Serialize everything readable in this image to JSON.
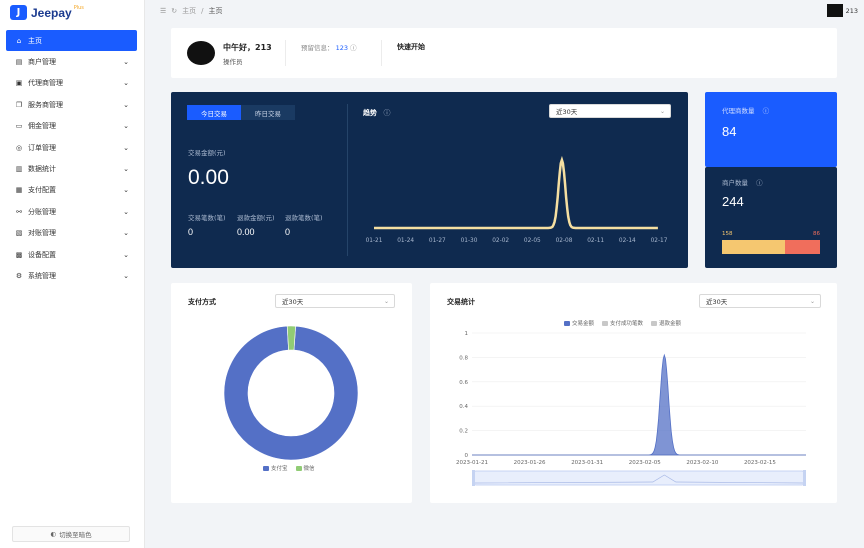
{
  "app": {
    "logo_text": "Jeepay",
    "logo_sup": "Plus",
    "logo_mark": "J"
  },
  "sidebar": {
    "items": [
      {
        "label": "主页",
        "icon": "home-icon",
        "glyph": "⌂",
        "active": true
      },
      {
        "label": "商户管理",
        "icon": "store-icon",
        "glyph": "▤"
      },
      {
        "label": "代理商管理",
        "icon": "agent-icon",
        "glyph": "▣"
      },
      {
        "label": "服务商管理",
        "icon": "provider-icon",
        "glyph": "❐"
      },
      {
        "label": "佣金管理",
        "icon": "commission-icon",
        "glyph": "▭"
      },
      {
        "label": "订单管理",
        "icon": "order-icon",
        "glyph": "◎"
      },
      {
        "label": "数据统计",
        "icon": "stats-icon",
        "glyph": "▥"
      },
      {
        "label": "支付配置",
        "icon": "pay-config-icon",
        "glyph": "▦"
      },
      {
        "label": "分账管理",
        "icon": "split-icon",
        "glyph": "⚯"
      },
      {
        "label": "对账管理",
        "icon": "reconcile-icon",
        "glyph": "▧"
      },
      {
        "label": "设备配置",
        "icon": "device-icon",
        "glyph": "▩"
      },
      {
        "label": "系统管理",
        "icon": "system-icon",
        "glyph": "⚙"
      }
    ],
    "chevron": "⌄",
    "theme_button": "切换至暗色",
    "theme_glyph": "◐"
  },
  "topbar": {
    "menu_glyph": "☰",
    "refresh_glyph": "↻",
    "crumb_home": "主页",
    "crumb_sep": "/",
    "crumb_current": "主页",
    "username": "213"
  },
  "welcome": {
    "greeting": "中午好，213",
    "role": "操作员",
    "notice_label": "预留信息：",
    "notice_value": "123",
    "notice_info_glyph": "ⓘ",
    "quick_start": "快速开始"
  },
  "transactions": {
    "tab_today": "今日交易",
    "tab_yesterday": "昨日交易",
    "amount_label": "交易金额(元)",
    "amount_value": "0.00",
    "count_label": "交易笔数(笔)",
    "count_value": "0",
    "refund_amount_label": "退款金额(元)",
    "refund_amount_value": "0.00",
    "refund_count_label": "退款笔数(笔)",
    "refund_count_value": "0",
    "trend_title": "趋势",
    "trend_info_glyph": "ⓘ",
    "trend_range": "近30天",
    "select_arrow": "⌄"
  },
  "counts": {
    "agent_label": "代理商数量",
    "agent_value": "84",
    "merchant_label": "商户数量",
    "merchant_value": "244",
    "info_glyph": "ⓘ",
    "bar_left_label": "158",
    "bar_right_label": "86",
    "bar_left_value": 158,
    "bar_right_value": 86,
    "bar_left_color": "#f5c770",
    "bar_right_color": "#f06e5c"
  },
  "pay_methods": {
    "title": "支付方式",
    "range": "近30天",
    "legend": [
      {
        "name": "支付宝",
        "color": "#5470c6"
      },
      {
        "name": "微信",
        "color": "#91cc75"
      }
    ]
  },
  "stats": {
    "title": "交易统计",
    "range": "近30天",
    "legend": [
      {
        "name": "交易金额",
        "color": "#5470c6"
      },
      {
        "name": "支付成功笔数",
        "color": "#c8c8c8"
      },
      {
        "name": "退款金额",
        "color": "#c8c8c8"
      }
    ]
  },
  "chart_data": [
    {
      "type": "line",
      "title": "趋势",
      "categories": [
        "01-21",
        "01-24",
        "01-27",
        "01-30",
        "02-02",
        "02-05",
        "02-08",
        "02-11",
        "02-14",
        "02-17"
      ],
      "x_days": [
        0,
        3,
        6,
        9,
        12,
        15,
        18,
        21,
        24,
        27
      ],
      "peak_day": 17.8,
      "peak_value": 1,
      "color": "#f5dfa1"
    },
    {
      "type": "pie",
      "title": "支付方式",
      "labels": [
        "支付宝",
        "微信"
      ],
      "values": [
        98,
        2
      ],
      "colors": [
        "#5470c6",
        "#91cc75"
      ]
    },
    {
      "type": "area",
      "title": "交易统计",
      "x_ticks": [
        "2023-01-21",
        "2023-01-26",
        "2023-01-31",
        "2023-02-05",
        "2023-02-10",
        "2023-02-15"
      ],
      "y_ticks": [
        "0",
        "0.2",
        "0.4",
        "0.6",
        "0.8",
        "1"
      ],
      "ylim": [
        0,
        1
      ],
      "series": [
        {
          "name": "交易金额",
          "peak_date": "2023-02-07",
          "peak_value": 0.82,
          "color": "#5470c6"
        }
      ]
    }
  ]
}
